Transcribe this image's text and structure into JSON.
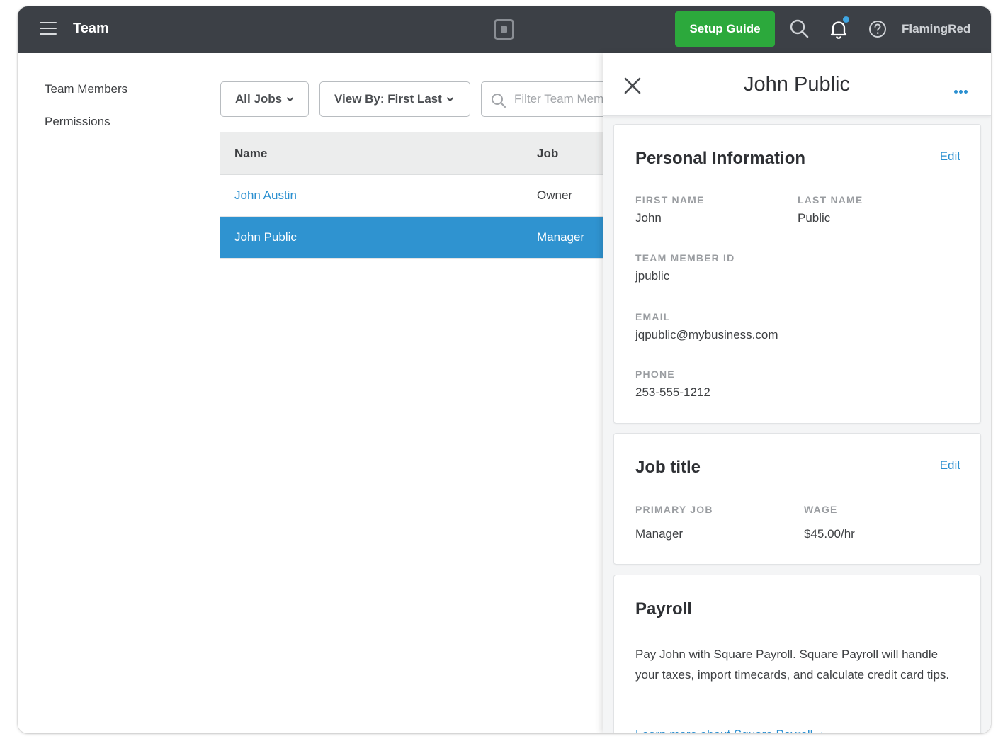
{
  "header": {
    "title": "Team",
    "setup_guide_label": "Setup Guide",
    "user_name": "FlamingRed",
    "icons": [
      "menu-icon",
      "square-logo-icon",
      "search-icon",
      "bell-icon",
      "help-icon"
    ],
    "has_notification": true
  },
  "sidebar": {
    "items": [
      {
        "label": "Team Members"
      },
      {
        "label": "Permissions"
      }
    ]
  },
  "filters": {
    "jobs_label": "All Jobs",
    "view_by_label": "View By: First Last",
    "search_placeholder": "Filter Team Members"
  },
  "table": {
    "headers": {
      "name": "Name",
      "job": "Job"
    },
    "rows": [
      {
        "name": "John Austin",
        "job": "Owner",
        "selected": false
      },
      {
        "name": "John Public",
        "job": "Manager",
        "selected": true
      }
    ]
  },
  "panel": {
    "title": "John Public",
    "personal": {
      "heading": "Personal Information",
      "edit_label": "Edit",
      "first_name_label": "FIRST NAME",
      "first_name": "John",
      "last_name_label": "LAST NAME",
      "last_name": "Public",
      "member_id_label": "TEAM MEMBER ID",
      "member_id": "jpublic",
      "email_label": "EMAIL",
      "email": "jqpublic@mybusiness.com",
      "phone_label": "PHONE",
      "phone": "253-555-1212"
    },
    "job": {
      "heading": "Job title",
      "edit_label": "Edit",
      "primary_job_label": "PRIMARY JOB",
      "primary_job": "Manager",
      "wage_label": "WAGE",
      "wage": "$45.00/hr"
    },
    "payroll": {
      "heading": "Payroll",
      "text": "Pay John with Square Payroll. Square Payroll will handle your taxes, import timecards, and calculate credit card tips.",
      "link_label": "Learn more about Square Payroll"
    }
  },
  "colors": {
    "topbar": "#3c4046",
    "accent_green": "#2ca93c",
    "link_blue": "#2a8fd0",
    "selected_row": "#2f93d0"
  }
}
